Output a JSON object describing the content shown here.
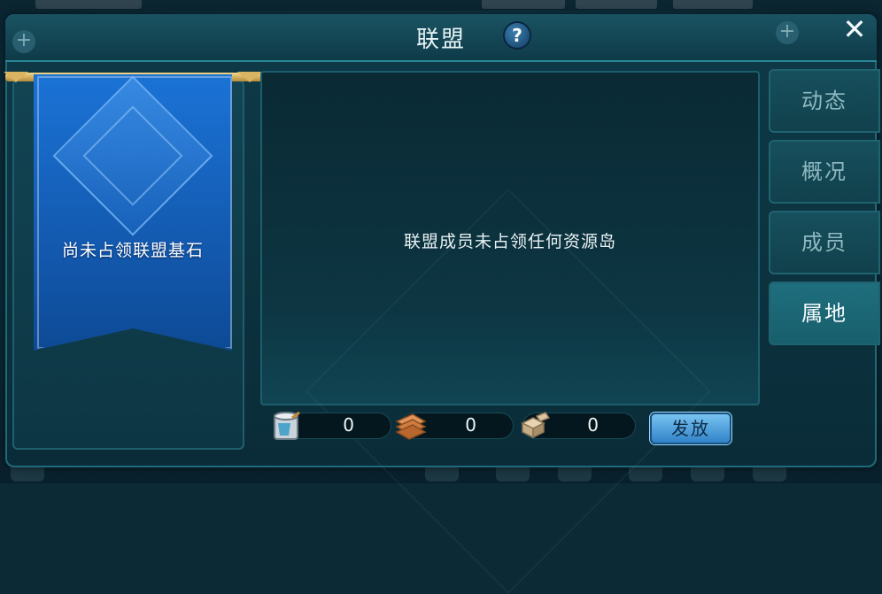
{
  "window": {
    "title": "联盟",
    "help_label": "?",
    "close_label": "✕"
  },
  "banner": {
    "status_text": "尚未占领联盟基石"
  },
  "main": {
    "empty_message": "联盟成员未占领任何资源岛"
  },
  "resources": [
    {
      "icon": "paint-bucket-icon",
      "value": "0"
    },
    {
      "icon": "wood-planks-icon",
      "value": "0"
    },
    {
      "icon": "stone-blocks-icon",
      "value": "0"
    }
  ],
  "distribute_button": "发放",
  "tabs": [
    {
      "label": "动态",
      "active": false
    },
    {
      "label": "概况",
      "active": false
    },
    {
      "label": "成员",
      "active": false
    },
    {
      "label": "属地",
      "active": true
    }
  ],
  "colors": {
    "accent": "#2d7fc6",
    "banner": "#1b73d6",
    "panel": "#0d3542"
  }
}
